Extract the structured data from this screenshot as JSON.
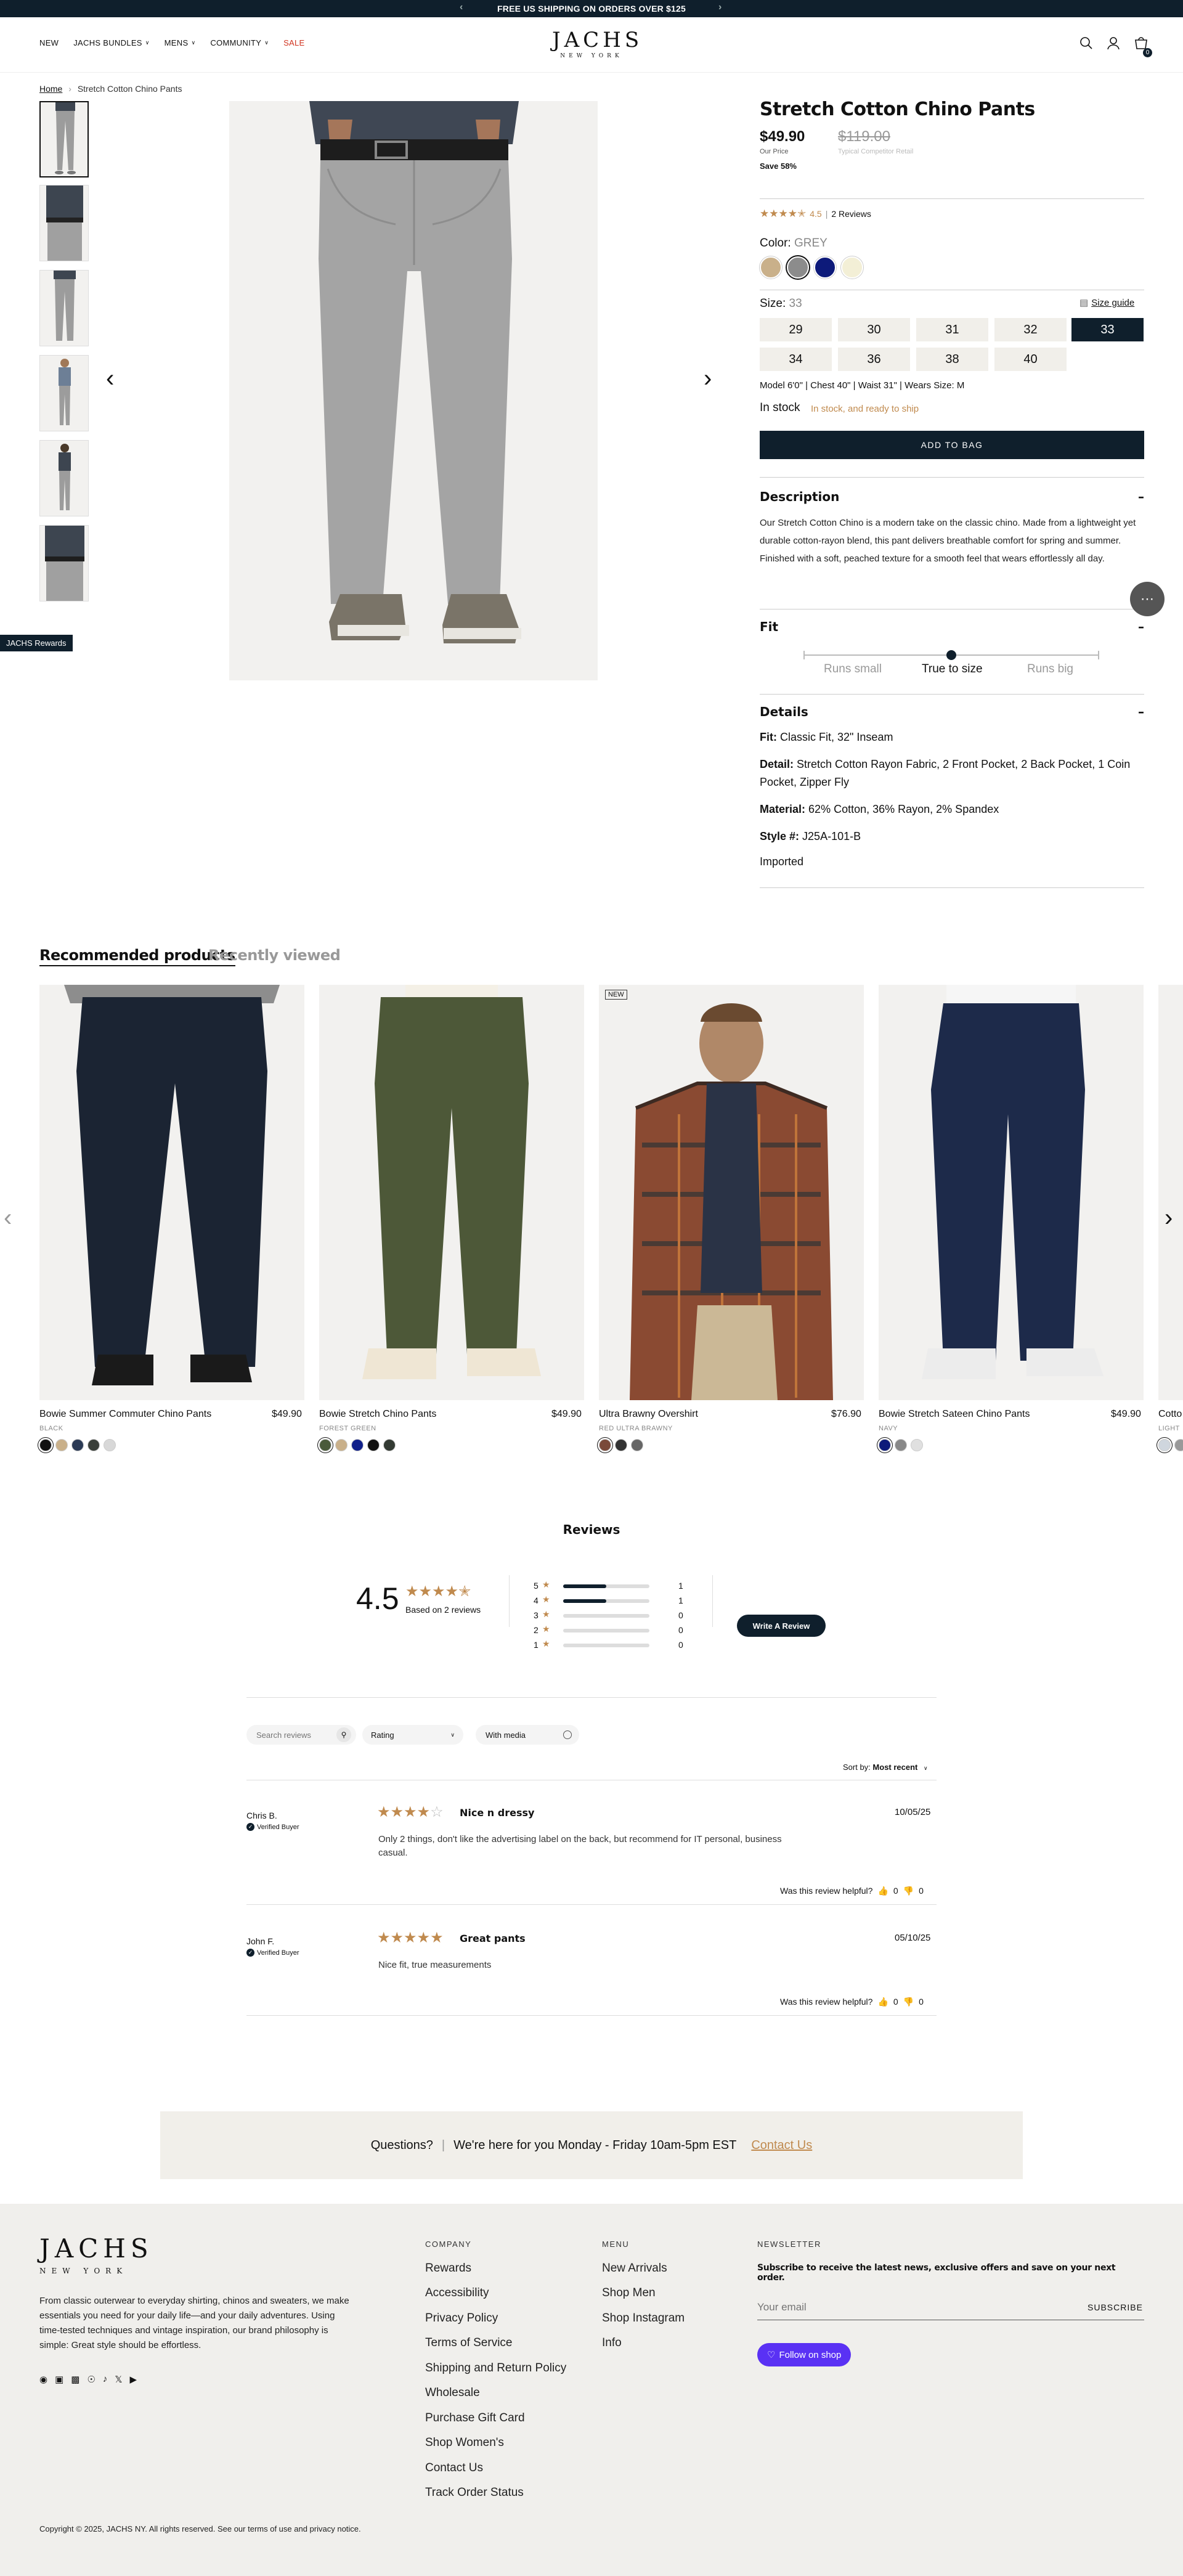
{
  "announcement": {
    "text": "FREE US SHIPPING ON ORDERS OVER $125",
    "prev": "‹",
    "next": "›"
  },
  "nav": {
    "items": [
      "NEW",
      "JACHS BUNDLES",
      "MENS",
      "COMMUNITY",
      "SALE"
    ],
    "sale_color": "#d0321e"
  },
  "logo": {
    "line1": "JACHS",
    "line2": "NEW YORK"
  },
  "cart": {
    "count": "0"
  },
  "breadcrumb": {
    "home": "Home",
    "sep": "›",
    "current": "Stretch Cotton Chino Pants"
  },
  "rewards": {
    "label": "JACHS Rewards"
  },
  "product": {
    "title": "Stretch Cotton Chino Pants",
    "price": "$49.90",
    "compare_price": "$119.00",
    "our_price_label": "Our Price",
    "compare_label": "Typical Competitor Retail",
    "save": "Save 58%",
    "rating_value": "4.5",
    "reviews_link": "2 Reviews",
    "color_label": "Color:",
    "color_value": "GREY",
    "swatches": [
      "#c9b08a",
      "#8c8c8c",
      "#0d1a7a",
      "#f3efd6"
    ],
    "size_label": "Size:",
    "size_value": "33",
    "size_guide": "Size guide",
    "sizes": [
      "29",
      "30",
      "31",
      "32",
      "33",
      "34",
      "36",
      "38",
      "40"
    ],
    "model_info": "Model 6'0\" | Chest 40\" | Waist 31\" | Wears Size: M",
    "stock": "In stock",
    "stock_note": "In stock, and ready to ship",
    "add_to_bag": "ADD TO BAG",
    "description_title": "Description",
    "description": "Our Stretch Cotton Chino is a modern take on the classic chino. Made from a lightweight yet durable cotton-rayon blend, this pant delivers breathable comfort for spring and summer. Finished with a soft, peached texture for a smooth feel that wears effortlessly all day.",
    "fit_title": "Fit",
    "fit_small": "Runs small",
    "fit_true": "True to size",
    "fit_big": "Runs big",
    "fit_level": 0.5,
    "details_title": "Details",
    "details": [
      {
        "k": "Fit:",
        "v": "Classic Fit, 32\" Inseam"
      },
      {
        "k": "Detail:",
        "v": "Stretch Cotton Rayon Fabric, 2 Front Pocket, 2 Back Pocket, 1 Coin Pocket, Zipper Fly"
      },
      {
        "k": "Material:",
        "v": "62% Cotton, 36% Rayon, 2% Spandex"
      },
      {
        "k": "Style #:",
        "v": "J25A-101-B"
      }
    ],
    "imported": "Imported"
  },
  "recommended": {
    "tab_active": "Recommended products",
    "tab_inactive": "Recently viewed",
    "cards": [
      {
        "name": "Bowie Summer Commuter Chino Pants",
        "price": "$49.90",
        "color": "BLACK",
        "badge": "",
        "dots": [
          "#111111",
          "#c9b08a",
          "#2b3a55",
          "#3a3f3a",
          "#d8d8d8"
        ]
      },
      {
        "name": "Bowie Stretch Chino Pants",
        "price": "$49.90",
        "color": "FOREST GREEN",
        "badge": "",
        "dots": [
          "#4a5a3a",
          "#c9b08a",
          "#10208a",
          "#111111",
          "#333a33"
        ]
      },
      {
        "name": "Ultra Brawny Overshirt",
        "price": "$76.90",
        "color": "RED ULTRA BRAWNY",
        "badge": "NEW",
        "dots": [
          "#7a4a3a",
          "#333333",
          "#666666"
        ]
      },
      {
        "name": "Bowie Stretch Sateen Chino Pants",
        "price": "$49.90",
        "color": "NAVY",
        "badge": "",
        "dots": [
          "#0d1a7a",
          "#888888",
          "#e0e0e0"
        ]
      },
      {
        "name": "Cotto",
        "price": "",
        "color": "LIGHT",
        "badge": "",
        "dots": [
          "#cfd6de",
          "#999999"
        ]
      }
    ]
  },
  "reviews": {
    "title": "Reviews",
    "average": "4.5",
    "based_on": "Based on 2 reviews",
    "dist": [
      {
        "stars": "5",
        "count": "1",
        "level": 0.5
      },
      {
        "stars": "4",
        "count": "1",
        "level": 0.5
      },
      {
        "stars": "3",
        "count": "0",
        "level": 0
      },
      {
        "stars": "2",
        "count": "0",
        "level": 0
      },
      {
        "stars": "1",
        "count": "0",
        "level": 0
      }
    ],
    "write_button": "Write A Review",
    "search_placeholder": "Search reviews",
    "rating_select": "Rating",
    "with_media": "With media",
    "sort_label": "Sort by:",
    "sort_value": "Most recent",
    "helpful_label": "Was this review helpful?",
    "items": [
      {
        "author": "Chris B.",
        "verified": "Verified Buyer",
        "stars": 4,
        "title": "Nice n dressy",
        "date": "10/05/25",
        "body": "Only 2 things, don't like the advertising label on the back, but recommend for IT personal, business casual.",
        "up": "0",
        "down": "0"
      },
      {
        "author": "John F.",
        "verified": "Verified Buyer",
        "stars": 5,
        "title": "Great pants",
        "date": "05/10/25",
        "body": "Nice fit, true measurements",
        "up": "0",
        "down": "0"
      }
    ]
  },
  "questions": {
    "label": "Questions?",
    "hours": "We're here for you Monday - Friday 10am-5pm EST",
    "contact": "Contact Us"
  },
  "footer": {
    "logo1": "JACHS",
    "logo2": "NEW YORK",
    "about": "From classic outerwear to everyday shirting, chinos and sweaters, we make essentials you need for your daily life—and your daily adventures. Using time-tested techniques and vintage inspiration, our brand philosophy is simple: Great style should be effortless.",
    "company_title": "COMPANY",
    "company": [
      "Rewards",
      "Accessibility",
      "Privacy Policy",
      "Terms of Service",
      "Shipping and Return Policy",
      "Wholesale",
      "Purchase Gift Card",
      "Shop Women's",
      "Contact Us",
      "Track Order Status"
    ],
    "menu_title": "MENU",
    "menu": [
      "New Arrivals",
      "Shop Men",
      "Shop Instagram",
      "Info"
    ],
    "newsletter_title": "NEWSLETTER",
    "newsletter_text": "Subscribe to receive the latest news, exclusive offers and save on your next order.",
    "email_placeholder": "Your email",
    "subscribe": "SUBSCRIBE",
    "follow": "Follow on shop",
    "copyright": "Copyright © 2025, JACHS NY. All rights reserved. See our terms of use and privacy notice."
  },
  "colors": {
    "navy": "#0f1f2c",
    "gold": "#c08a4e",
    "shop": "#5a31f4"
  }
}
